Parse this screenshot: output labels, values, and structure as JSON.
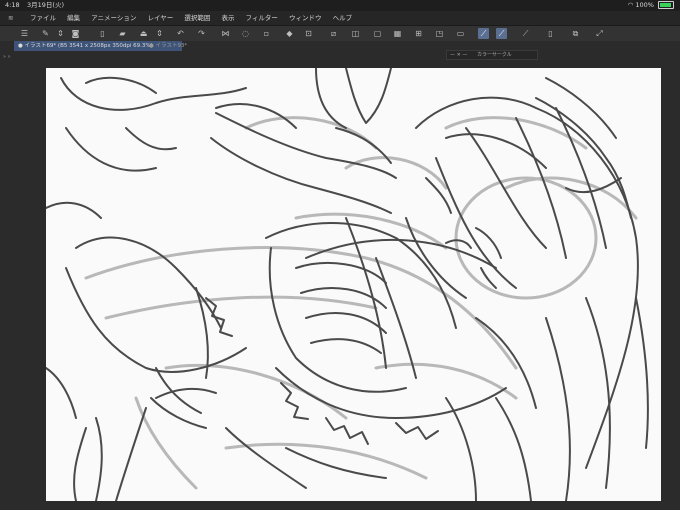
{
  "status_bar": {
    "time": "4:18",
    "date": "3月19日(火)",
    "battery": "100%"
  },
  "menu": {
    "items": [
      "ファイル",
      "編集",
      "アニメーション",
      "レイヤー",
      "選択範囲",
      "表示",
      "フィルター",
      "ウィンドウ",
      "ヘルプ"
    ]
  },
  "tabs": {
    "active": "● イラスト69* (B5 3541 x 2508px 350dpi 69.3%)",
    "inactive": "● イラスト93*"
  },
  "panel": {
    "title": "カラーサークル",
    "controls": "— ✕ —"
  },
  "left_strip": {
    "mark": "» »"
  },
  "toolbar_icons": [
    "menu-icon",
    "edit-icon",
    "spin-icon",
    "new-icon",
    "open-icon",
    "save-icon",
    "arrow-icon",
    "undo-icon",
    "redo-icon",
    "snap-icon",
    "lasso-icon",
    "crop-icon",
    "fill-icon",
    "transform-icon",
    "select-all-icon",
    "grid-icon",
    "ruler-icon",
    "layer-icon",
    "chart-icon",
    "pen-icon",
    "settings-icon",
    "grid2-icon",
    "expand-icon"
  ],
  "colors": {
    "accent": "#5a6f91",
    "tab_active": "#3d5478",
    "canvas": "#fafafa",
    "background": "#2b2b2b"
  }
}
